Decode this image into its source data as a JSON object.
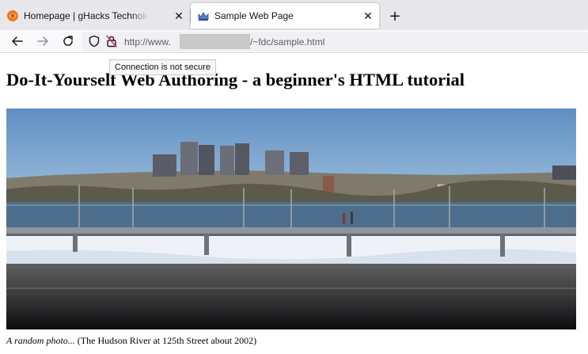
{
  "browser": {
    "tabs": [
      {
        "title": "Homepage | gHacks Technology News",
        "favicon": "ghacks-logo-icon",
        "active": false
      },
      {
        "title": "Sample Web Page",
        "favicon": "crown-icon",
        "active": true
      }
    ],
    "new_tab_label": "+",
    "close_glyph": "✕",
    "address": {
      "prefix": "http://www.",
      "suffix": "/~fdc/sample.html"
    },
    "tooltip": "Connection is not secure"
  },
  "page": {
    "heading": "Do-It-Yourself Web Authoring - a beginner's HTML tutorial",
    "photo_caption_italic": "A random photo...",
    "photo_caption_text": "(The Hudson River at 125th Street about 2002)"
  },
  "colors": {
    "tab_strip": "#e8e7ec",
    "nav_bar": "#f9f9fb",
    "url_field": "#f0f0f4",
    "sky": "#6c98c6",
    "river": "#4c6e8c",
    "ghacks_orange": "#f07b1c"
  }
}
